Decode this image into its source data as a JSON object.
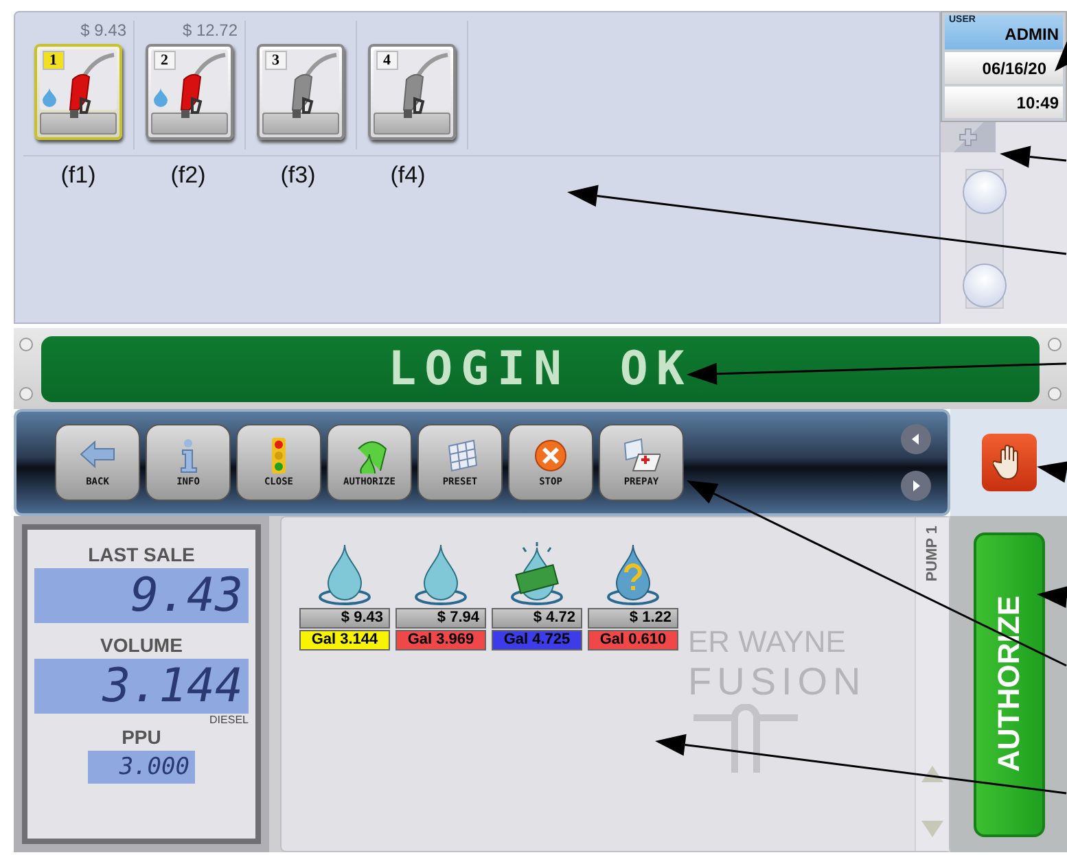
{
  "pumps": [
    {
      "number": "1",
      "amount": "$ 9.43",
      "key": "(f1)",
      "selected": true,
      "active": true,
      "fueling": true
    },
    {
      "number": "2",
      "amount": "$ 12.72",
      "key": "(f2)",
      "selected": false,
      "active": true,
      "fueling": true
    },
    {
      "number": "3",
      "key": "(f3)",
      "selected": false,
      "active": false,
      "fueling": false
    },
    {
      "number": "4",
      "key": "(f4)",
      "selected": false,
      "active": false,
      "fueling": false
    }
  ],
  "user_panel": {
    "label": "USER",
    "user": "ADMIN",
    "date": "06/16/20",
    "time": "10:49"
  },
  "message": "LOGIN OK",
  "toolbar": [
    {
      "kind": "back",
      "label": "BACK"
    },
    {
      "kind": "info",
      "label": "INFO"
    },
    {
      "kind": "close",
      "label": "CLOSE"
    },
    {
      "kind": "authorize",
      "label": "AUTHORIZE"
    },
    {
      "kind": "preset",
      "label": "PRESET"
    },
    {
      "kind": "stop",
      "label": "STOP"
    },
    {
      "kind": "prepay",
      "label": "PREPAY"
    }
  ],
  "display": {
    "last_sale_label": "LAST SALE",
    "last_sale": "9.43",
    "volume_label": "VOLUME",
    "volume": "3.144",
    "grade": "DIESEL",
    "ppu_label": "PPU",
    "ppu": "3.000"
  },
  "pump_label": "PUMP 1",
  "logo": {
    "line1": "ER WAYNE",
    "line2": "FUSION"
  },
  "sales": [
    {
      "kind": "drop",
      "amount": "$ 9.43",
      "volume": "Gal 3.144",
      "color": "#f8f400"
    },
    {
      "kind": "drop",
      "amount": "$ 7.94",
      "volume": "Gal 3.969",
      "color": "#f04848"
    },
    {
      "kind": "cash",
      "amount": "$ 4.72",
      "volume": "Gal 4.725",
      "color": "#3c3ce8"
    },
    {
      "kind": "unknown",
      "amount": "$ 1.22",
      "volume": "Gal 0.610",
      "color": "#f04848"
    }
  ],
  "authorize_button": "AUTHORIZE"
}
